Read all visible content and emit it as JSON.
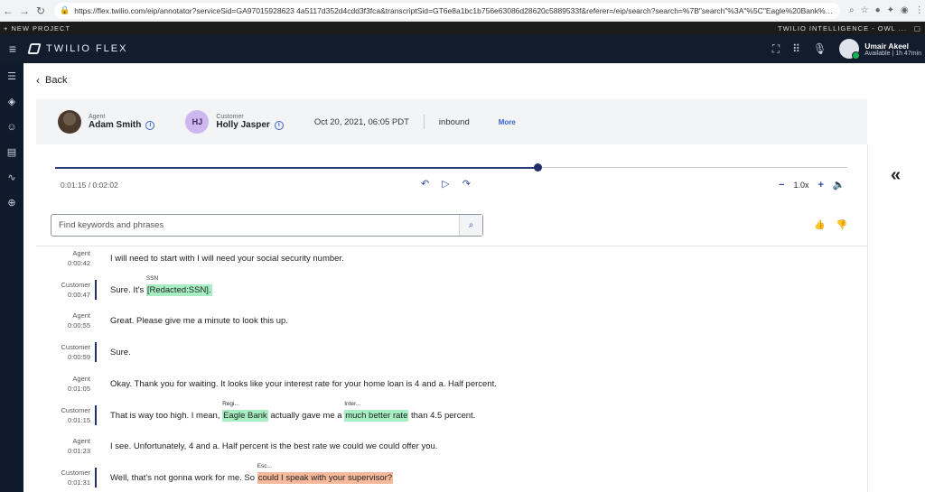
{
  "browser": {
    "url": "https://flex.twilio.com/eip/annotator?serviceSid=GA97015928623 4a5117d352d4cdd3f3fca&transcriptSid=GT6e8a1bc1b756e63086d28620c5889533f&referer=/eip/search?search=%7B\"search\"%3A\"%5C\"Eagle%20Bank%5C\"\"%2C\"dateRange\"%..."
  },
  "project_bar": {
    "left_label": "+ NEW PROJECT",
    "right_label": "TWILIO INTELLIGENCE - OWL ..."
  },
  "header": {
    "brand": "TWILIO FLEX",
    "user_name": "Umair Akeel",
    "user_status": "Available | 1h 47min"
  },
  "back": {
    "label": "Back"
  },
  "meta": {
    "agent_role": "Agent",
    "agent_name": "Adam Smith",
    "customer_role": "Customer",
    "customer_initials": "HJ",
    "customer_name": "Holly Jasper",
    "date": "Oct 20, 2021, 06:05 PDT",
    "direction": "inbound",
    "more_label": "More"
  },
  "player": {
    "time": "0:01:15 / 0:02:02",
    "progress": 0.61,
    "speed": "1.0x"
  },
  "search": {
    "placeholder": "Find keywords and phrases"
  },
  "transcript": [
    {
      "speaker": "Agent",
      "time": "0:00:42",
      "segments": [
        {
          "text": "I will need to start with I will need your social security number."
        }
      ]
    },
    {
      "speaker": "Customer",
      "time": "0:00:47",
      "segments": [
        {
          "text": "Sure. It's "
        },
        {
          "text": "[Redacted:SSN].",
          "hl": "green",
          "tag": "SSN"
        }
      ]
    },
    {
      "speaker": "Agent",
      "time": "0:00:55",
      "segments": [
        {
          "text": "Great. Please give me a minute to look this up."
        }
      ]
    },
    {
      "speaker": "Customer",
      "time": "0:00:59",
      "segments": [
        {
          "text": "Sure."
        }
      ]
    },
    {
      "speaker": "Agent",
      "time": "0:01:05",
      "segments": [
        {
          "text": "Okay. Thank you for waiting. It looks like your interest rate for your home loan is 4 and a. Half percent."
        }
      ]
    },
    {
      "speaker": "Customer",
      "time": "0:01:15",
      "segments": [
        {
          "text": "That is way too high. I mean, "
        },
        {
          "text": "Eagle Bank",
          "hl": "green",
          "tag": "Regi..."
        },
        {
          "text": " actually gave me a "
        },
        {
          "text": "much better rate",
          "hl": "green",
          "tag": "Inter..."
        },
        {
          "text": " than 4.5 percent."
        }
      ]
    },
    {
      "speaker": "Agent",
      "time": "0:01:23",
      "segments": [
        {
          "text": "I see. Unfortunately, 4 and a. Half percent is the best rate we could we could offer you."
        }
      ]
    },
    {
      "speaker": "Customer",
      "time": "0:01:31",
      "segments": [
        {
          "text": "Well, that's not gonna work for me. So "
        },
        {
          "text": "could I speak with your supervisor?",
          "hl": "orange",
          "tag": "Esc..."
        }
      ]
    }
  ]
}
